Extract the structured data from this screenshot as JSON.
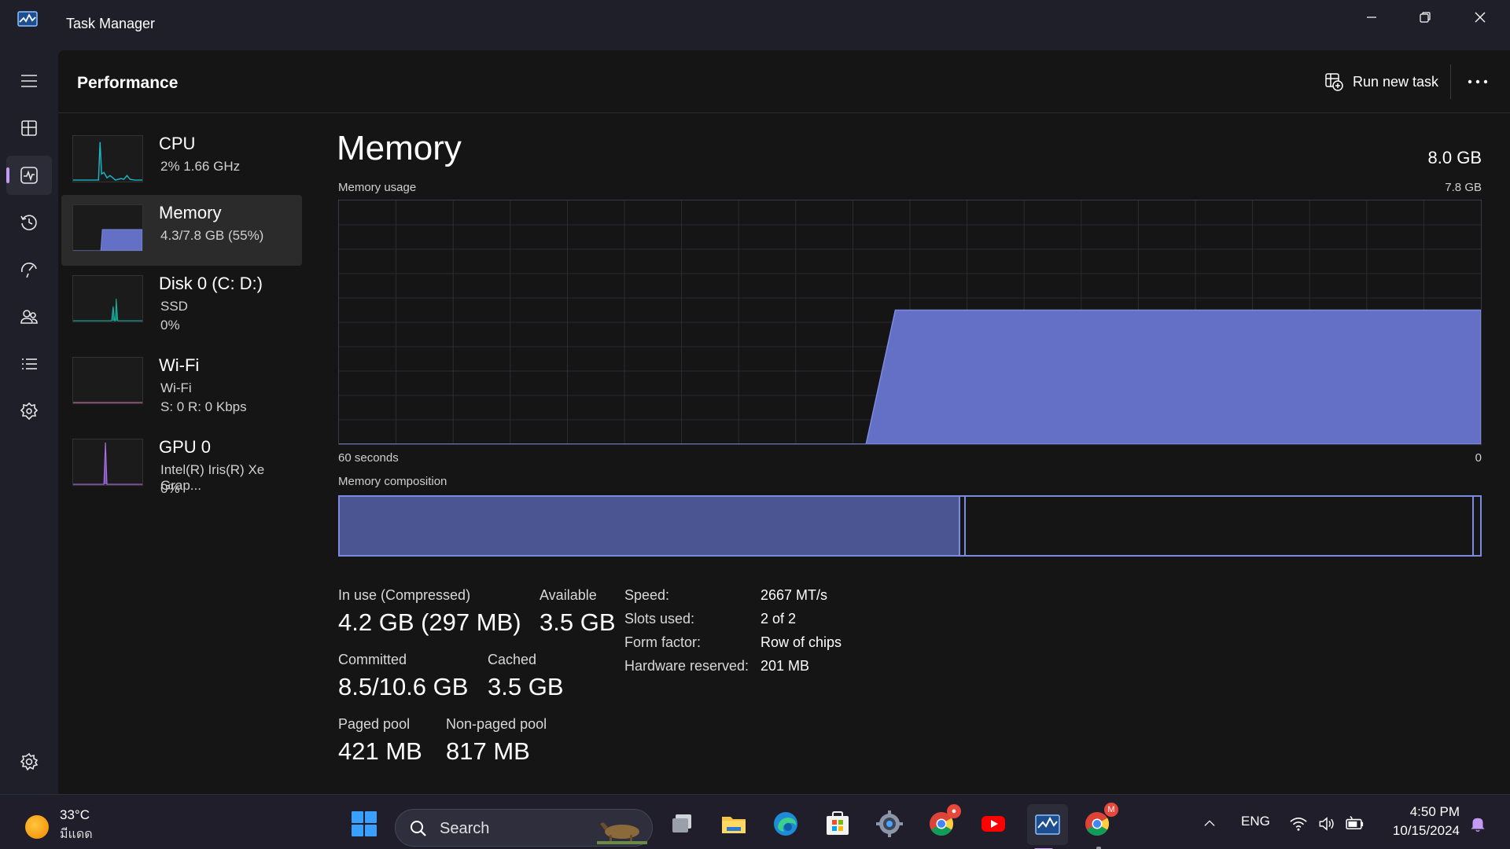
{
  "window": {
    "title": "Task Manager"
  },
  "header": {
    "page_title": "Performance",
    "run_new_task_label": "Run new task"
  },
  "devices": [
    {
      "name": "CPU",
      "line1": "2%  1.66 GHz",
      "line2": ""
    },
    {
      "name": "Memory",
      "line1": "4.3/7.8 GB (55%)",
      "line2": ""
    },
    {
      "name": "Disk 0 (C: D:)",
      "line1": "SSD",
      "line2": "0%"
    },
    {
      "name": "Wi-Fi",
      "line1": "Wi-Fi",
      "line2": "S: 0 R: 0 Kbps"
    },
    {
      "name": "GPU 0",
      "line1": "Intel(R) Iris(R) Xe Grap...",
      "line2": "0%"
    }
  ],
  "memory": {
    "title": "Memory",
    "total": "8.0 GB",
    "usage_label": "Memory usage",
    "usage_max": "7.8 GB",
    "time_span": "60 seconds",
    "time_zero": "0",
    "composition_label": "Memory composition",
    "usage_history_fraction": [
      0,
      0,
      0,
      0,
      0,
      0,
      0,
      0,
      0,
      0,
      0,
      0,
      0,
      0,
      0,
      0,
      0,
      0,
      0,
      0.55,
      0.55,
      0.55,
      0.55,
      0.55,
      0.55,
      0.55,
      0.55,
      0.55,
      0.55,
      0.55,
      0.55,
      0.55,
      0.55,
      0.55,
      0.55,
      0.55,
      0.55,
      0.55,
      0.55,
      0.55
    ],
    "composition": {
      "in_use_fraction": 0.543,
      "modified_fraction": 0.006,
      "standby_fraction": 0.44
    },
    "stats": {
      "in_use_label": "In use (Compressed)",
      "in_use_value": "4.2 GB (297 MB)",
      "available_label": "Available",
      "available_value": "3.5 GB",
      "committed_label": "Committed",
      "committed_value": "8.5/10.6 GB",
      "cached_label": "Cached",
      "cached_value": "3.5 GB",
      "paged_label": "Paged pool",
      "paged_value": "421 MB",
      "nonpaged_label": "Non-paged pool",
      "nonpaged_value": "817 MB"
    },
    "specs": {
      "speed_label": "Speed:",
      "speed_value": "2667 MT/s",
      "slots_label": "Slots used:",
      "slots_value": "2 of 2",
      "form_label": "Form factor:",
      "form_value": "Row of chips",
      "hwres_label": "Hardware reserved:",
      "hwres_value": "201 MB"
    }
  },
  "taskbar": {
    "weather_temp": "33°C",
    "weather_desc": "มีแดด",
    "search_placeholder": "Search",
    "language": "ENG",
    "time": "4:50 PM",
    "date": "10/15/2024",
    "chrome_badge": "M"
  },
  "icons": [
    "app-icon",
    "hamburger-icon",
    "processes-icon",
    "performance-icon",
    "app-history-icon",
    "startup-apps-icon",
    "users-icon",
    "details-icon",
    "services-icon",
    "settings-icon",
    "run-task-icon",
    "more-icon",
    "windows-start-icon",
    "search-icon",
    "task-view-icon",
    "file-explorer-icon",
    "edge-icon",
    "microsoft-store-icon",
    "settings-app-icon",
    "chrome-icon",
    "youtube-icon",
    "task-manager-icon",
    "chrome-profile-icon",
    "chevron-up-icon",
    "wifi-icon",
    "volume-icon",
    "battery-icon",
    "notification-bell-icon"
  ],
  "colors": {
    "accent": "#c39bf5",
    "memory_fill": "#6470c6",
    "memory_stroke": "#7c8ae0",
    "cpu_line": "#17b5c5",
    "gpu_line": "#a86fe0",
    "wifi_line": "#c96fa8"
  }
}
